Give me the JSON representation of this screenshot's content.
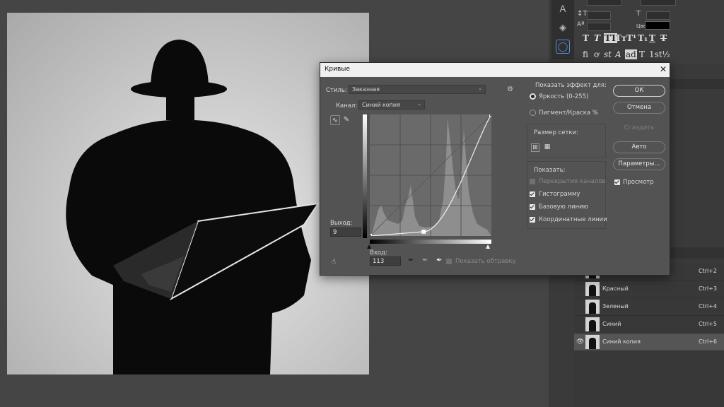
{
  "dialog": {
    "title": "Кривые",
    "style_label": "Стиль:",
    "style_value": "Заказная",
    "channel_label": "Канал:",
    "channel_value": "Синий копия",
    "output_label": "Выход:",
    "output_value": "9",
    "input_label": "Вход:",
    "input_value": "113",
    "show_clipping": "Показать обтравку",
    "show_effect_label": "Показать эффект для:",
    "radio_light": "Яркость (0-255)",
    "radio_pigment": "Пигмент/Краска %",
    "grid_size_label": "Размер сетки:",
    "show_label": "Показать:",
    "opt_channel_overlays": "Перекрытия каналов",
    "opt_histogram": "Гистограмму",
    "opt_baseline": "Базовую линию",
    "opt_intersection": "Координатные линии",
    "btn_ok": "ОК",
    "btn_cancel": "Отмена",
    "btn_smooth": "Сгладить",
    "btn_auto": "Авто",
    "btn_options": "Параметры...",
    "preview_label": "Просмотр"
  },
  "character_panel": {
    "color_label": "Цвет:",
    "glyphs_row1": [
      "T",
      "T",
      "TT",
      "Tт",
      "T¹",
      "T₁",
      "T",
      "T"
    ],
    "glyphs_row2": [
      "fi",
      "ơ",
      "st",
      "A",
      "ad",
      "T",
      "1st",
      "½"
    ]
  },
  "layers": [
    {
      "name": "",
      "shortcut": "Ctrl+2",
      "selected": false,
      "visible": false
    },
    {
      "name": "Красный",
      "shortcut": "Ctrl+3",
      "selected": false,
      "visible": false
    },
    {
      "name": "Зеленый",
      "shortcut": "Ctrl+4",
      "selected": false,
      "visible": false
    },
    {
      "name": "Синий",
      "shortcut": "Ctrl+5",
      "selected": false,
      "visible": false
    },
    {
      "name": "Синий копия",
      "shortcut": "Ctrl+6",
      "selected": true,
      "visible": true
    }
  ],
  "curve": {
    "points": [
      [
        0,
        0
      ],
      [
        113,
        9
      ],
      [
        255,
        255
      ]
    ]
  },
  "colors": {
    "accent": "#5b8bd8",
    "dialog_bg": "#535353"
  }
}
